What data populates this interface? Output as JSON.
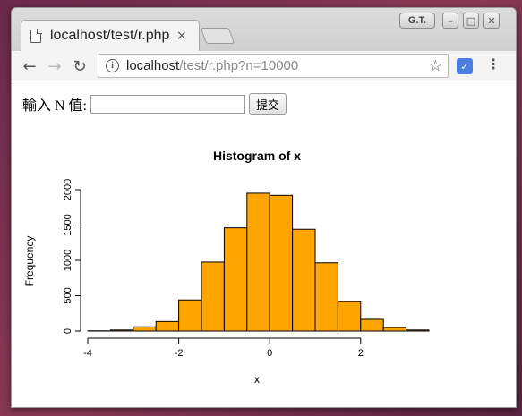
{
  "window": {
    "tab_title": "localhost/test/r.php",
    "tab_close": "×",
    "gt_label": "G.T.",
    "min": "–",
    "max": "□",
    "close": "✕"
  },
  "toolbar": {
    "back": "←",
    "forward": "→",
    "reload": "↻",
    "url_host": "localhost",
    "url_path": "/test/r.php?n=10000",
    "star": "☆",
    "menu": "⋮"
  },
  "form": {
    "label": "輸入 N 值:",
    "input_value": "",
    "submit_label": "提交"
  },
  "chart_data": {
    "type": "bar",
    "title": "Histogram of x",
    "xlabel": "x",
    "ylabel": "Frequency",
    "bin_edges": [
      -4,
      -3.5,
      -3,
      -2.5,
      -2,
      -1.5,
      -1,
      -0.5,
      0,
      0.5,
      1,
      1.5,
      2,
      2.5,
      3,
      3.5
    ],
    "values": [
      3,
      15,
      60,
      135,
      440,
      975,
      1460,
      1950,
      1920,
      1440,
      965,
      415,
      165,
      50,
      15
    ],
    "xticks": [
      -4,
      -2,
      0,
      2
    ],
    "yticks": [
      0,
      500,
      1000,
      1500,
      2000
    ],
    "xlim": [
      -4,
      3.5
    ],
    "ylim": [
      0,
      2000
    ],
    "bar_color": "#FFA500"
  }
}
